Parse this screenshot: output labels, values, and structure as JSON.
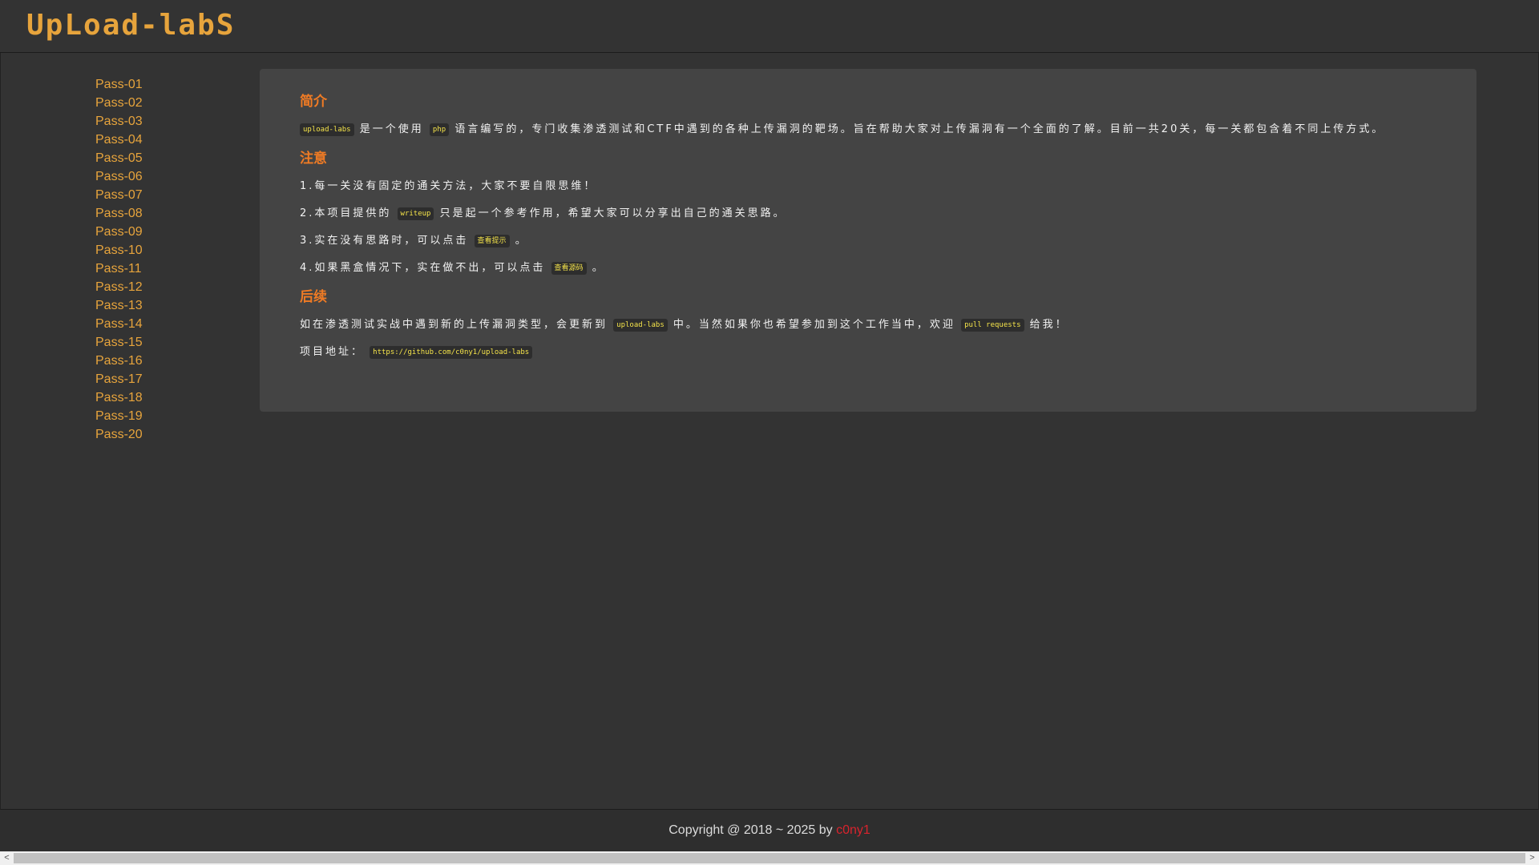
{
  "header": {
    "logo_text": "UpLoad-labS"
  },
  "sidebar": {
    "items": [
      {
        "label": "Pass-01"
      },
      {
        "label": "Pass-02"
      },
      {
        "label": "Pass-03"
      },
      {
        "label": "Pass-04"
      },
      {
        "label": "Pass-05"
      },
      {
        "label": "Pass-06"
      },
      {
        "label": "Pass-07"
      },
      {
        "label": "Pass-08"
      },
      {
        "label": "Pass-09"
      },
      {
        "label": "Pass-10"
      },
      {
        "label": "Pass-11"
      },
      {
        "label": "Pass-12"
      },
      {
        "label": "Pass-13"
      },
      {
        "label": "Pass-14"
      },
      {
        "label": "Pass-15"
      },
      {
        "label": "Pass-16"
      },
      {
        "label": "Pass-17"
      },
      {
        "label": "Pass-18"
      },
      {
        "label": "Pass-19"
      },
      {
        "label": "Pass-20"
      }
    ]
  },
  "content": {
    "intro": {
      "title": "简介",
      "code_uploadlabs": "upload-labs",
      "text_1": "是一个使用",
      "code_php": "php",
      "text_2": "语言编写的，专门收集渗透测试和CTF中遇到的各种上传漏洞的靶场。旨在帮助大家对上传漏洞有一个全面的了解。目前一共20关，每一关都包含着不同上传方式。"
    },
    "notice": {
      "title": "注意",
      "item1": "1.每一关没有固定的通关方法，大家不要自限思维！",
      "item2_pre": "2.本项目提供的",
      "item2_code": "writeup",
      "item2_post": "只是起一个参考作用，希望大家可以分享出自己的通关思路。",
      "item3_pre": "3.实在没有思路时，可以点击",
      "item3_code": "查看提示",
      "item3_post": "。",
      "item4_pre": "4.如果黑盒情况下，实在做不出，可以点击",
      "item4_code": "查看源码",
      "item4_post": "。"
    },
    "follow": {
      "title": "后续",
      "text_1": "如在渗透测试实战中遇到新的上传漏洞类型，会更新到",
      "code_uploadlabs": "upload-labs",
      "text_2": "中。当然如果你也希望参加到这个工作当中，欢迎",
      "code_pr": "pull requests",
      "text_3": "给我！",
      "address_label": "项目地址：",
      "address_url": "https://github.com/c0ny1/upload-labs"
    }
  },
  "footer": {
    "copyright": "Copyright @ 2018 ~ 2025 by ",
    "author": "c0ny1"
  },
  "scrollbar": {
    "left_arrow": "<",
    "right_arrow": ">"
  },
  "colors": {
    "accent": "#e7a43c",
    "section_title": "#f07b24",
    "code_text": "#f4e34a",
    "author": "#d9232d",
    "background": "#333333",
    "panel": "#444444"
  }
}
